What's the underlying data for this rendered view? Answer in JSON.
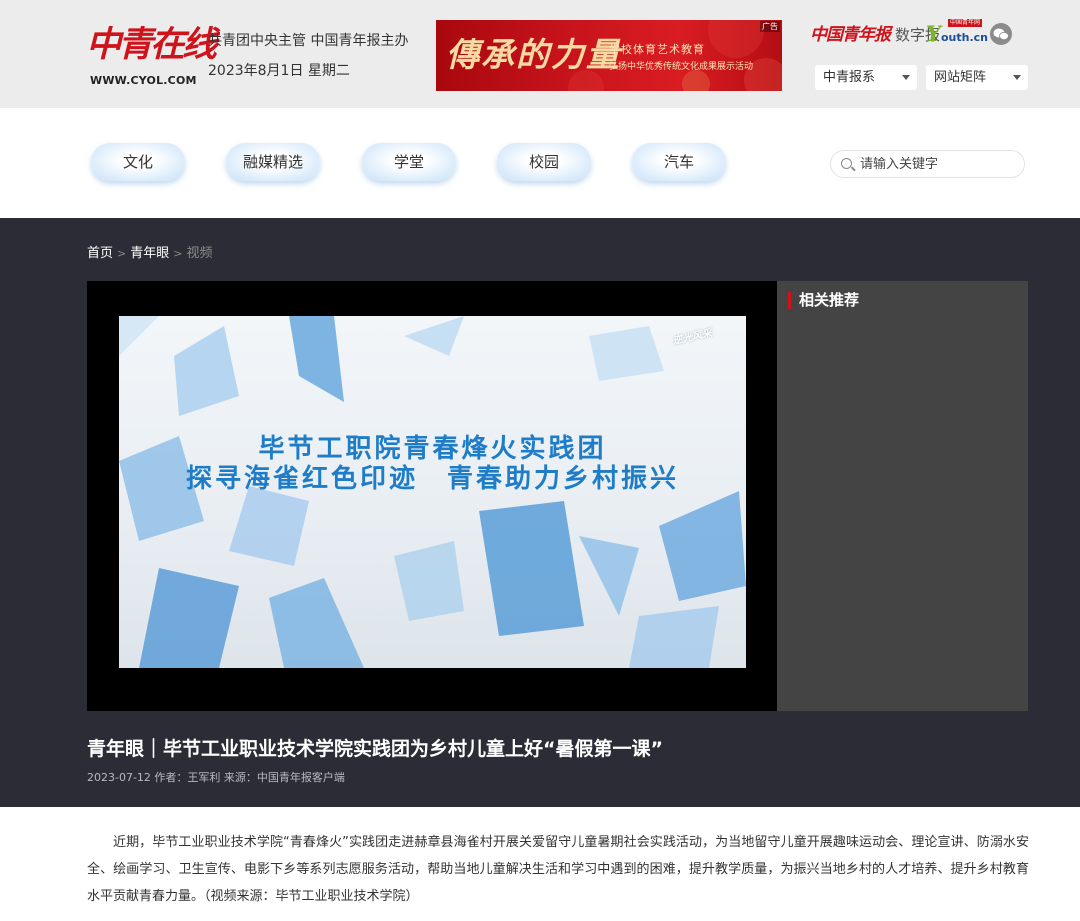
{
  "header": {
    "logo": {
      "text": "中青在线",
      "url_text": "WWW.CYOL.COM"
    },
    "sponsor_line": "共青团中央主管 中国青年报主办",
    "date_line": "2023年8月1日 星期二",
    "banner": {
      "title": "傳承的力量",
      "line1": "学校体育艺术教育",
      "line2": "弘扬中华优秀传统文化成果展示活动",
      "ad_tag": "广告"
    },
    "right_logos": {
      "cyd_name": "中国青年报",
      "cyd_sub": "数字报",
      "youth_y": "Y",
      "youth_text": "outh.cn",
      "youth_tag": "中国青年网",
      "wechat_icon": "wechat-icon"
    },
    "selects": [
      {
        "value": "中青报系"
      },
      {
        "value": "网站矩阵"
      }
    ]
  },
  "nav": {
    "items": [
      {
        "label": "文化"
      },
      {
        "label": "融媒精选"
      },
      {
        "label": "学堂"
      },
      {
        "label": "校园"
      },
      {
        "label": "汽车"
      }
    ],
    "search": {
      "placeholder": "请输入关键字",
      "icon": "search-icon"
    }
  },
  "breadcrumb": {
    "home": "首页",
    "section": "青年眼",
    "current": "视频",
    "separator": ">"
  },
  "video": {
    "title_line1": "毕节工职院青春烽火实践团",
    "title_line2": "探寻海雀红色印迹　青春助力乡村振兴",
    "watermark": "逆光风采"
  },
  "related": {
    "title": "相关推荐"
  },
  "article": {
    "title": "青年眼｜毕节工业职业技术学院实践团为乡村儿童上好“暑假第一课”",
    "meta": "2023-07-12 作者：王军利 来源：中国青年报客户端",
    "body": "近期，毕节工业职业技术学院“青春烽火”实践团走进赫章县海雀村开展关爱留守儿童暑期社会实践活动，为当地留守儿童开展趣味运动会、理论宣讲、防溺水安全、绘画学习、卫生宣传、电影下乡等系列志愿服务活动，帮助当地儿童解决生活和学习中遇到的困难，提升教学质量，为振兴当地乡村的人才培养、提升乡村教育水平贡献青春力量。（视频来源：毕节工业职业技术学院）"
  },
  "colors": {
    "brand_red": "#d0121b",
    "header_bg": "#ececec",
    "dark_bg": "#2c2c36",
    "related_bg": "#444444",
    "video_title_blue": "#1f7dc8"
  }
}
